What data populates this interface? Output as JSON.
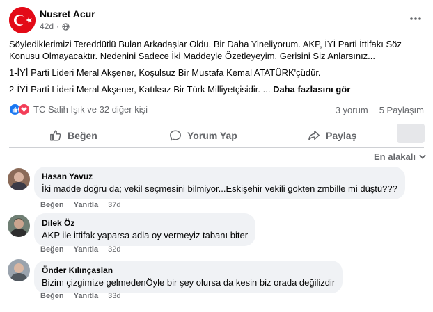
{
  "post": {
    "author": "Nusret Acur",
    "age": "42d",
    "paragraphs": [
      "Söylediklerimizi Tereddütlü Bulan Arkadaşlar Oldu. Bir Daha Yineliyorum. AKP, İYİ Parti İttifakı Söz Konusu Olmayacaktır. Nedenini Sadece İki Maddeyle Özetleyeyim. Gerisini Siz Anlarsınız...",
      "1-İYİ Parti Lideri Meral Akşener, Koşulsuz Bir Mustafa Kemal ATATÜRK'çüdür.",
      "2-İYİ Parti Lideri Meral Akşener, Katıksız Bir Türk Milliyetçisidir. ..."
    ],
    "see_more": "Daha fazlasını gör",
    "reactors": "TC Salih Işık ve 32 diğer kişi",
    "comments_count": "3 yorum",
    "shares_count": "5 Paylaşım"
  },
  "actions": {
    "like": "Beğen",
    "comment": "Yorum Yap",
    "share": "Paylaş"
  },
  "sort_label": "En alakalı",
  "comments": [
    {
      "name": "Hasan Yavuz",
      "text": "İki madde doğru da; vekil seçmesini bilmiyor...Eskişehir vekili gökten zmbille mi düştü???",
      "like": "Beğen",
      "reply": "Yanıtla",
      "age": "37d"
    },
    {
      "name": "Dilek Öz",
      "text": "AKP ile ittifak yaparsa adla oy vermeyiz tabanı biter",
      "like": "Beğen",
      "reply": "Yanıtla",
      "age": "32d"
    },
    {
      "name": "Önder Kılınçaslan",
      "text": "Bizim çizgimize gelmedenÖyle bir şey olursa da kesin biz orada değilizdir",
      "like": "Beğen",
      "reply": "Yanıtla",
      "age": "33d"
    }
  ],
  "colors": {
    "primary_text": "#050505",
    "secondary_text": "#65676b",
    "bubble_bg": "#f0f2f5",
    "like_blue": "#1877f2",
    "love_red": "#f33e58",
    "flag_red": "#e30a17"
  }
}
